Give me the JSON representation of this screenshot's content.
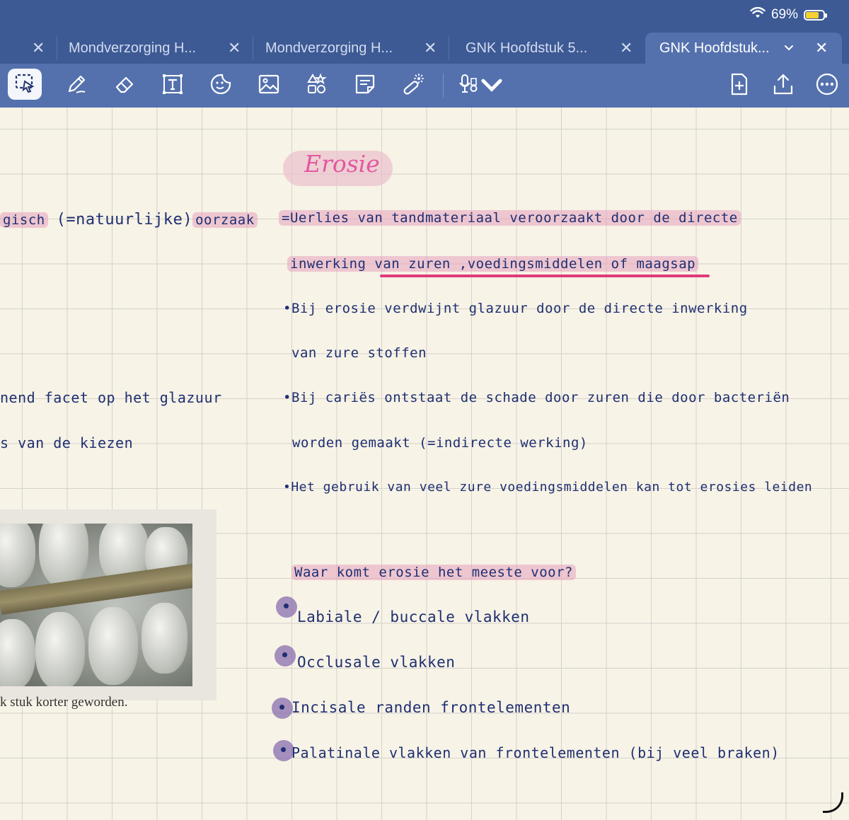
{
  "status": {
    "battery_percent": "69%",
    "battery_level": 0.69
  },
  "tabs": [
    {
      "label": "Mondverzorging H...",
      "active": false
    },
    {
      "label": "Mondverzorging H...",
      "active": false
    },
    {
      "label": "GNK Hoofdstuk 5...",
      "active": false
    },
    {
      "label": "GNK Hoofdstuk...",
      "active": true
    }
  ],
  "toolbar": {
    "tools": [
      "lasso-select-icon",
      "pen-icon",
      "eraser-icon",
      "text-box-icon",
      "sticker-icon",
      "image-icon",
      "shapes-icon",
      "sticky-note-icon",
      "laser-pointer-icon",
      "audio-record-icon"
    ],
    "right_tools": [
      "add-page-icon",
      "share-icon",
      "more-icon"
    ]
  },
  "colors": {
    "ink": "#1f2f72",
    "highlight": "#e8a0be",
    "title": "#e3589f",
    "underline": "#e03b7c",
    "chrome": "#3d5a95",
    "toolbar": "#5471ae"
  },
  "left_notes": {
    "line1_a": "gisch",
    "line1_b": "(=natuurlijke)",
    "line1_c": "oorzaak",
    "line2": "nend facet op het glazuur",
    "line3": "s van de kiezen"
  },
  "photo": {
    "caption": "k stuk korter geworden."
  },
  "note": {
    "title": "Erosie",
    "def_line1": "=Uerlies van tandmateriaal veroorzaakt door de directe",
    "def_line2": "inwerking van zuren ,voedingsmiddelen of maagsap",
    "b1_line1": "•Bij erosie verdwijnt glazuur door de directe inwerking",
    "b1_line2": "van zure stoffen",
    "b2_line1": "•Bij cariës ontstaat de schade door zuren die door bacteriën",
    "b2_line2": "worden gemaakt (=indirecte werking)",
    "b3_line1": "•Het gebruik van veel zure voedingsmiddelen kan tot erosies leiden",
    "question": "Waar komt erosie het meeste voor?",
    "answers": [
      "Labiale / buccale vlakken",
      "Occlusale vlakken",
      "Incisale randen frontelementen",
      "Palatinale vlakken van frontelementen (bij veel braken)"
    ]
  }
}
